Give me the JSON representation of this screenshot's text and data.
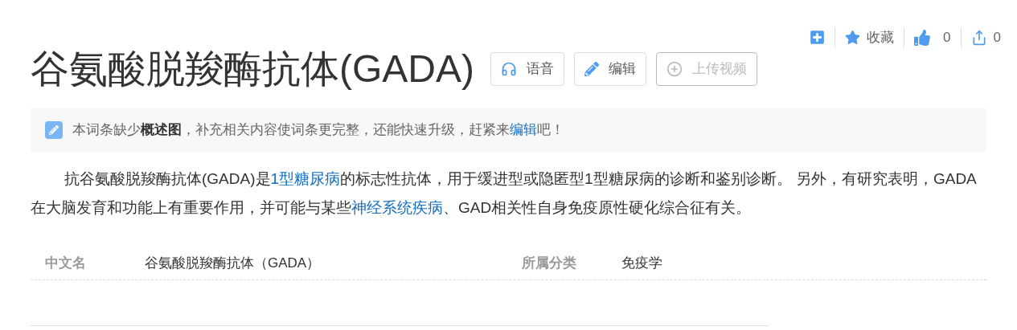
{
  "actions": [
    {
      "kind": "add"
    },
    {
      "kind": "star",
      "label": "收藏"
    },
    {
      "kind": "like",
      "label": "0"
    },
    {
      "kind": "share",
      "label": "0"
    }
  ],
  "title": "谷氨酸脱羧酶抗体(GADA)",
  "title_buttons": [
    {
      "kind": "audio",
      "label": "语音",
      "disabled": false
    },
    {
      "kind": "edit",
      "label": "编辑",
      "disabled": false
    },
    {
      "kind": "upload",
      "label": "上传视频",
      "disabled": true
    }
  ],
  "notice": [
    {
      "kind": "text",
      "text": "本词条缺少"
    },
    {
      "kind": "bold",
      "text": "概述图"
    },
    {
      "kind": "text",
      "text": "，补充相关内容使词条更完整，还能快速升级，赶紧来"
    },
    {
      "kind": "link",
      "text": "编辑"
    },
    {
      "kind": "text",
      "text": "吧！"
    }
  ],
  "summary": [
    {
      "kind": "text",
      "text": "抗谷氨酸脱羧酶抗体(GADA)是"
    },
    {
      "kind": "link",
      "text": "1型糖尿病"
    },
    {
      "kind": "text",
      "text": "的标志性抗体，用于缓进型或隐匿型1型糖尿病的诊断和鉴别诊断。 另外，有研究表明，GADA在大脑发育和功能上有重要作用，并可能与某些"
    },
    {
      "kind": "link",
      "text": "神经系统疾病"
    },
    {
      "kind": "text",
      "text": "、GAD相关性自身免疫原性硬化综合征有关。"
    }
  ],
  "basic_info": [
    {
      "name": "中文名",
      "value": "谷氨酸脱羧酶抗体（GADA）"
    },
    {
      "name": "所属分类",
      "value": "免疫学"
    }
  ]
}
